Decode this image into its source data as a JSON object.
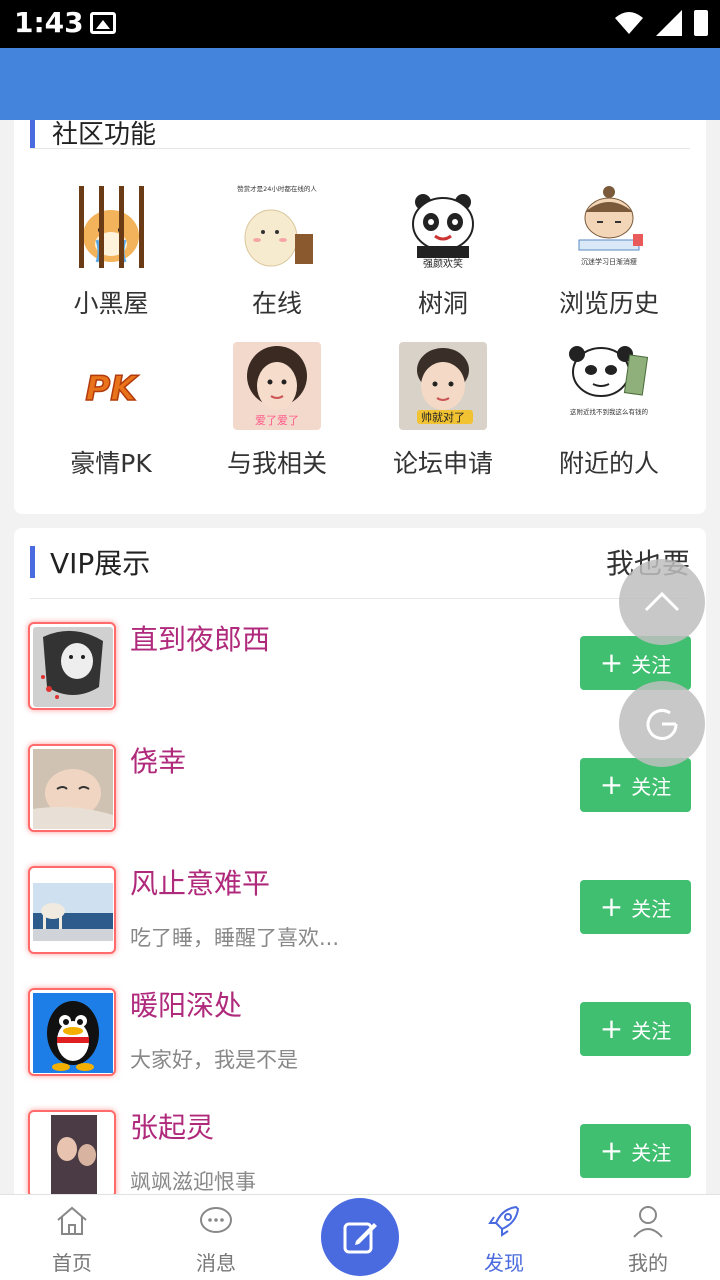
{
  "status_bar": {
    "time": "1:43"
  },
  "features": {
    "title": "社区功能",
    "items": [
      {
        "label": "小黑屋",
        "icon": "jail-cat-sticker"
      },
      {
        "label": "在线",
        "icon": "online-sticker",
        "caption": "赞赏才是24小时都在线的人"
      },
      {
        "label": "树洞",
        "icon": "panda-sticker",
        "caption": "强颜欢笑"
      },
      {
        "label": "浏览历史",
        "icon": "history-sticker",
        "caption": "沉迷学习日渐消瘦"
      },
      {
        "label": "豪情PK",
        "icon": "pk-icon",
        "caption": "PK"
      },
      {
        "label": "与我相关",
        "icon": "girl-photo",
        "caption": "爱了爱了"
      },
      {
        "label": "论坛申请",
        "icon": "baby-photo",
        "caption": "帅就对了"
      },
      {
        "label": "附近的人",
        "icon": "panda-money-sticker",
        "caption": "这附近找不到我这么有钱的"
      }
    ]
  },
  "vip": {
    "title": "VIP展示",
    "more_label": "我也要",
    "follow_label": "关注",
    "users": [
      {
        "name": "直到夜郎西",
        "bio": ""
      },
      {
        "name": "侥幸",
        "bio": ""
      },
      {
        "name": "风止意难平",
        "bio": "吃了睡，睡醒了喜欢..."
      },
      {
        "name": "暖阳深处",
        "bio": "大家好，我是不是"
      },
      {
        "name": "张起灵",
        "bio": "飒飒滋迎恨事"
      }
    ]
  },
  "tabbar": {
    "items": [
      {
        "label": "首页",
        "icon": "home-icon"
      },
      {
        "label": "消息",
        "icon": "message-icon"
      },
      {
        "label": "发现",
        "icon": "rocket-icon",
        "active": true
      },
      {
        "label": "我的",
        "icon": "user-icon"
      }
    ],
    "center_icon": "edit-icon"
  },
  "colors": {
    "header": "#4484dc",
    "accent": "#4a6adf",
    "follow": "#3fbf6f",
    "vip_name": "#b02a7c"
  }
}
